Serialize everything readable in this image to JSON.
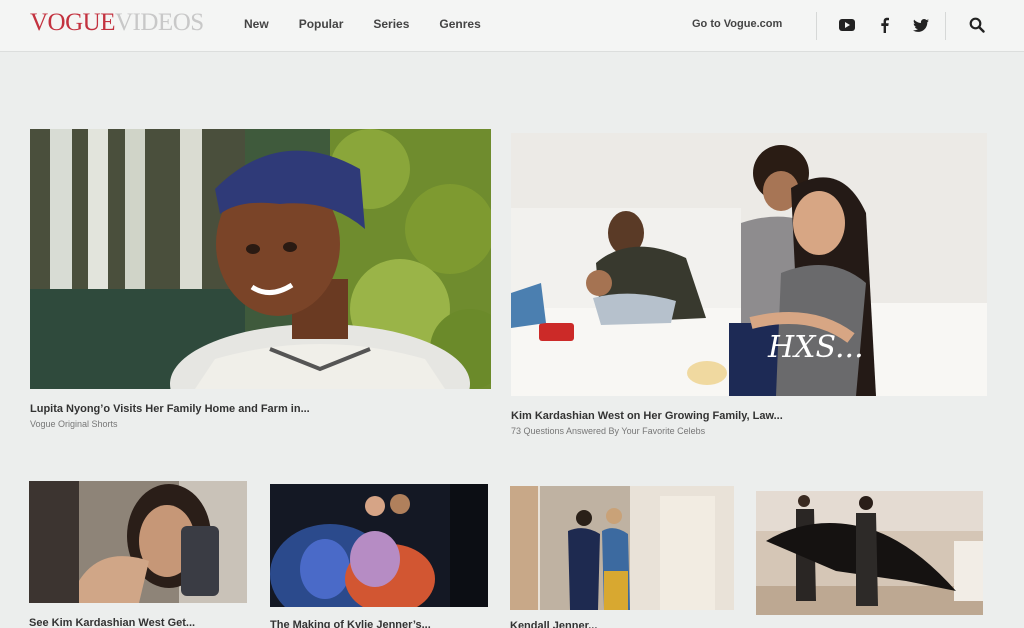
{
  "brand": {
    "vogue": "VOGUE",
    "videos": "VIDEOS"
  },
  "nav": {
    "items": [
      {
        "label": "New"
      },
      {
        "label": "Popular"
      },
      {
        "label": "Series"
      },
      {
        "label": "Genres"
      }
    ]
  },
  "header": {
    "goto_label": "Go to Vogue.com"
  },
  "icons": {
    "youtube": "youtube-icon",
    "facebook": "facebook-icon",
    "twitter": "twitter-icon",
    "search": "search-icon"
  },
  "colors": {
    "brand_red": "#c3323f",
    "header_bg": "#f4f5f4",
    "page_bg": "#eceeed"
  },
  "featured": [
    {
      "title": "Lupita Nyong’o Visits Her Family Home and Farm in...",
      "subtitle": "Vogue Original Shorts"
    },
    {
      "title": "Kim Kardashian West on Her Growing Family, Law...",
      "subtitle": "73 Questions Answered By Your Favorite Celebs",
      "watermark": "HXS..."
    }
  ],
  "grid": [
    {
      "title": "See Kim Kardashian West Get..."
    },
    {
      "title": "The Making of Kylie Jenner’s..."
    },
    {
      "title": "Kendall Jenner..."
    },
    {
      "title": ""
    }
  ]
}
